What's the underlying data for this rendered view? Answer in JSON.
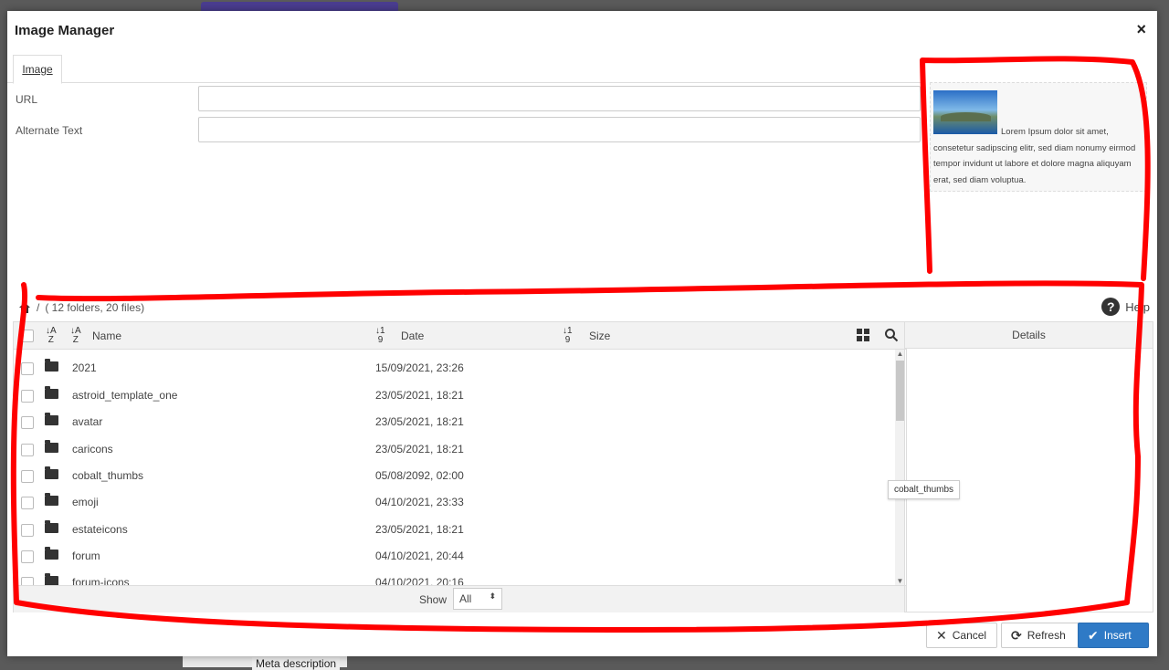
{
  "dialog": {
    "title": "Image Manager"
  },
  "tabs": [
    {
      "label": "Image"
    }
  ],
  "form": {
    "url": {
      "label": "URL",
      "value": ""
    },
    "alt": {
      "label": "Alternate Text",
      "value": ""
    }
  },
  "preview": {
    "text": "Lorem Ipsum dolor sit amet, consetetur sadipscing elitr, sed diam nonumy eirmod tempor invidunt ut labore et dolore magna aliquyam erat, sed diam voluptua."
  },
  "browser": {
    "breadcrumb_sep": "/",
    "summary": "( 12 folders, 20 files)",
    "help_label": "Help",
    "columns": {
      "name": "Name",
      "date": "Date",
      "size": "Size"
    },
    "details_label": "Details",
    "rows": [
      {
        "name": "2021",
        "date": "15/09/2021, 23:26"
      },
      {
        "name": "astroid_template_one",
        "date": "23/05/2021, 18:21"
      },
      {
        "name": "avatar",
        "date": "23/05/2021, 18:21"
      },
      {
        "name": "caricons",
        "date": "23/05/2021, 18:21"
      },
      {
        "name": "cobalt_thumbs",
        "date": "05/08/2092, 02:00"
      },
      {
        "name": "emoji",
        "date": "04/10/2021, 23:33"
      },
      {
        "name": "estateicons",
        "date": "23/05/2021, 18:21"
      },
      {
        "name": "forum",
        "date": "04/10/2021, 20:44"
      },
      {
        "name": "forum-icons",
        "date": "04/10/2021, 20:16"
      }
    ],
    "tooltip": "cobalt_thumbs",
    "show_label": "Show",
    "show_value": "All"
  },
  "buttons": {
    "cancel": "Cancel",
    "refresh": "Refresh",
    "insert": "Insert"
  },
  "background": {
    "meta_label": "Meta description"
  },
  "colors": {
    "annotation": "#ff0000",
    "primary": "#2f7ac6"
  }
}
